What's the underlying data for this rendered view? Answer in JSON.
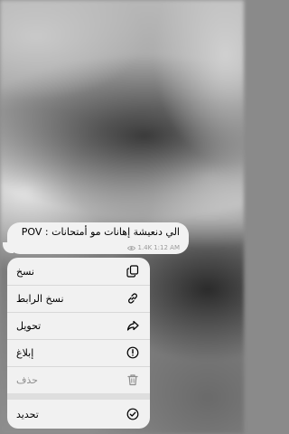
{
  "message": {
    "text": "الي دنعيشة إهانات مو أمتحانات : POV",
    "views": "1.4K",
    "time": "1:12 AM"
  },
  "menu": {
    "items": [
      {
        "label": "نسخ",
        "icon": "copy-icon"
      },
      {
        "label": "نسخ الرابط",
        "icon": "link-icon"
      },
      {
        "label": "تحويل",
        "icon": "forward-icon"
      },
      {
        "label": "إبلاغ",
        "icon": "report-icon"
      },
      {
        "label": "حذف",
        "icon": "trash-icon"
      }
    ],
    "select": {
      "label": "تحديد",
      "icon": "check-circle-icon"
    }
  }
}
